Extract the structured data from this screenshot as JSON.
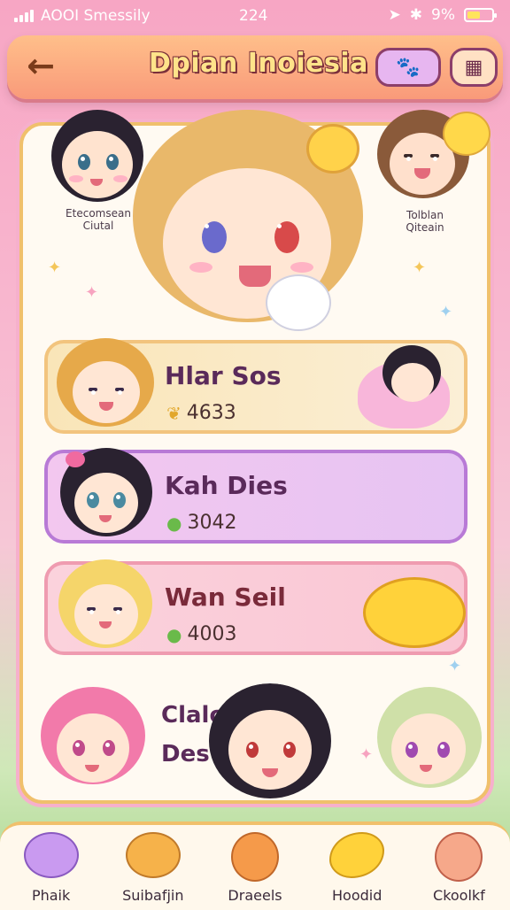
{
  "status_bar": {
    "carrier": "AOOI Smessily",
    "time": "224",
    "battery": "9%",
    "signal_icon": "signal-bars-icon",
    "wifi_icon": "location-arrow-icon",
    "bluetooth_icon": "bluetooth-icon"
  },
  "header": {
    "title": "Dpian Inoiesia",
    "back_icon": "back-arrow-icon",
    "pet_icon": "pet-paw-icon",
    "gift_icon": "gift-box-icon"
  },
  "featured": {
    "left_label_line1": "Etecomsean",
    "left_label_line2": "Ciutal",
    "right_label_line1": "Tolblan",
    "right_label_line2": "Qiteain"
  },
  "leaderboard": [
    {
      "name": "Hlar Sos",
      "score": "4633",
      "score_icon": "gold-leaf-icon"
    },
    {
      "name": "Kah Dies",
      "score": "3042",
      "score_icon": "green-apple-icon"
    },
    {
      "name": "Wan Seil",
      "score": "4003",
      "score_icon": "green-apple-icon"
    }
  ],
  "partial_entry": {
    "line1": "Clalo",
    "line2": "Des"
  },
  "nav": [
    {
      "label": "Phaik",
      "icon": "purple-slime-icon"
    },
    {
      "label": "Suibafjin",
      "icon": "orange-cat-icon"
    },
    {
      "label": "Draeels",
      "icon": "orange-drop-icon"
    },
    {
      "label": "Hoodid",
      "icon": "yellow-banana-icon"
    },
    {
      "label": "Ckoolkf",
      "icon": "keyhole-icon"
    }
  ],
  "colors": {
    "background_top": "#f7a6c4",
    "header": "#f99a7a",
    "title": "#ffe38a",
    "panel_border": "#f0c06c",
    "row1": "#f9e5b8",
    "row2": "#e6c4f3",
    "row3": "#f9c6d4"
  }
}
